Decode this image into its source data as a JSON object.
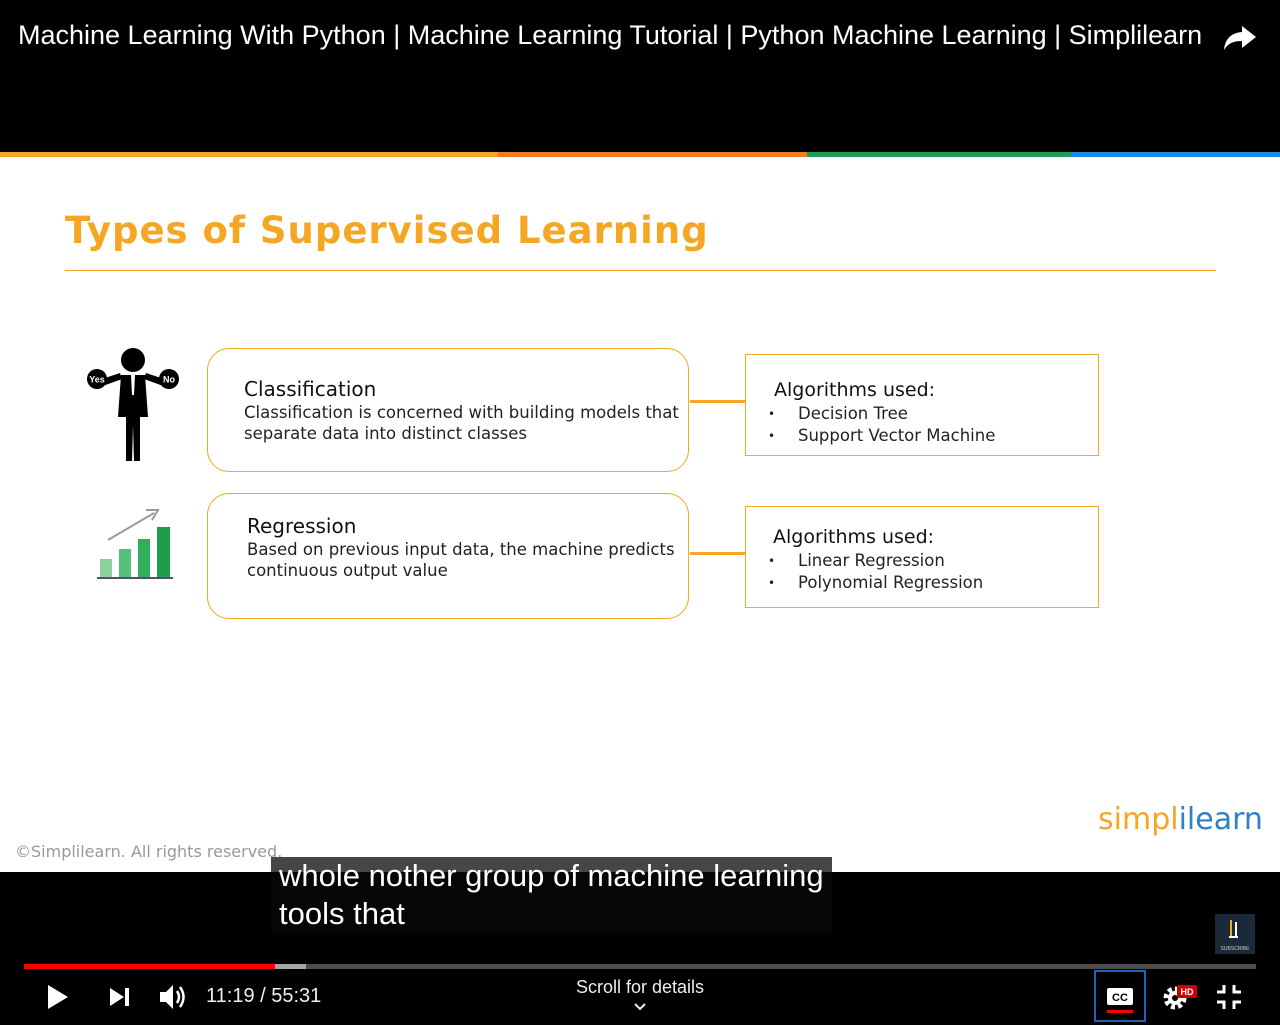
{
  "header": {
    "video_title": "Machine Learning With Python | Machine Learning Tutorial | Python Machine Learning | Simplilearn",
    "share_icon": "share-arrow-icon"
  },
  "stripe_colors": [
    "#f5a623",
    "#f07b28",
    "#1f9d55",
    "#1e88e5"
  ],
  "slide": {
    "title": "Types of Supervised Learning",
    "accent": "#f5a623",
    "rows": [
      {
        "icon": "person-yes-no-icon",
        "icon_yes": "Yes",
        "icon_no": "No",
        "heading": "Classification",
        "description": "Classification is concerned with building models that separate data into distinct classes",
        "algorithms_heading": "Algorithms used:",
        "algorithms": [
          "Decision Tree",
          "Support Vector Machine"
        ]
      },
      {
        "icon": "bar-growth-icon",
        "heading": "Regression",
        "description": "Based on previous input data, the machine predicts continuous output value",
        "algorithms_heading": "Algorithms used:",
        "algorithms": [
          "Linear Regression",
          "Polynomial Regression"
        ]
      }
    ],
    "copyright": "©Simplilearn. All rights reserved.",
    "brand_part1": "simpl",
    "brand_part2": "i",
    "brand_part3": "learn"
  },
  "captions": {
    "line1": "whole nother group of machine learning",
    "line2": "tools that"
  },
  "player": {
    "current_time": "11:19",
    "duration": "55:31",
    "time_text": "11:19 / 55:31",
    "played_fraction": 0.204,
    "buffered_fraction": 0.229,
    "played_color": "#ff0000",
    "scroll_hint": "Scroll for details",
    "hd_badge": "HD",
    "cc_label": "CC",
    "subscribe_label": "SUBSCRIBE"
  }
}
